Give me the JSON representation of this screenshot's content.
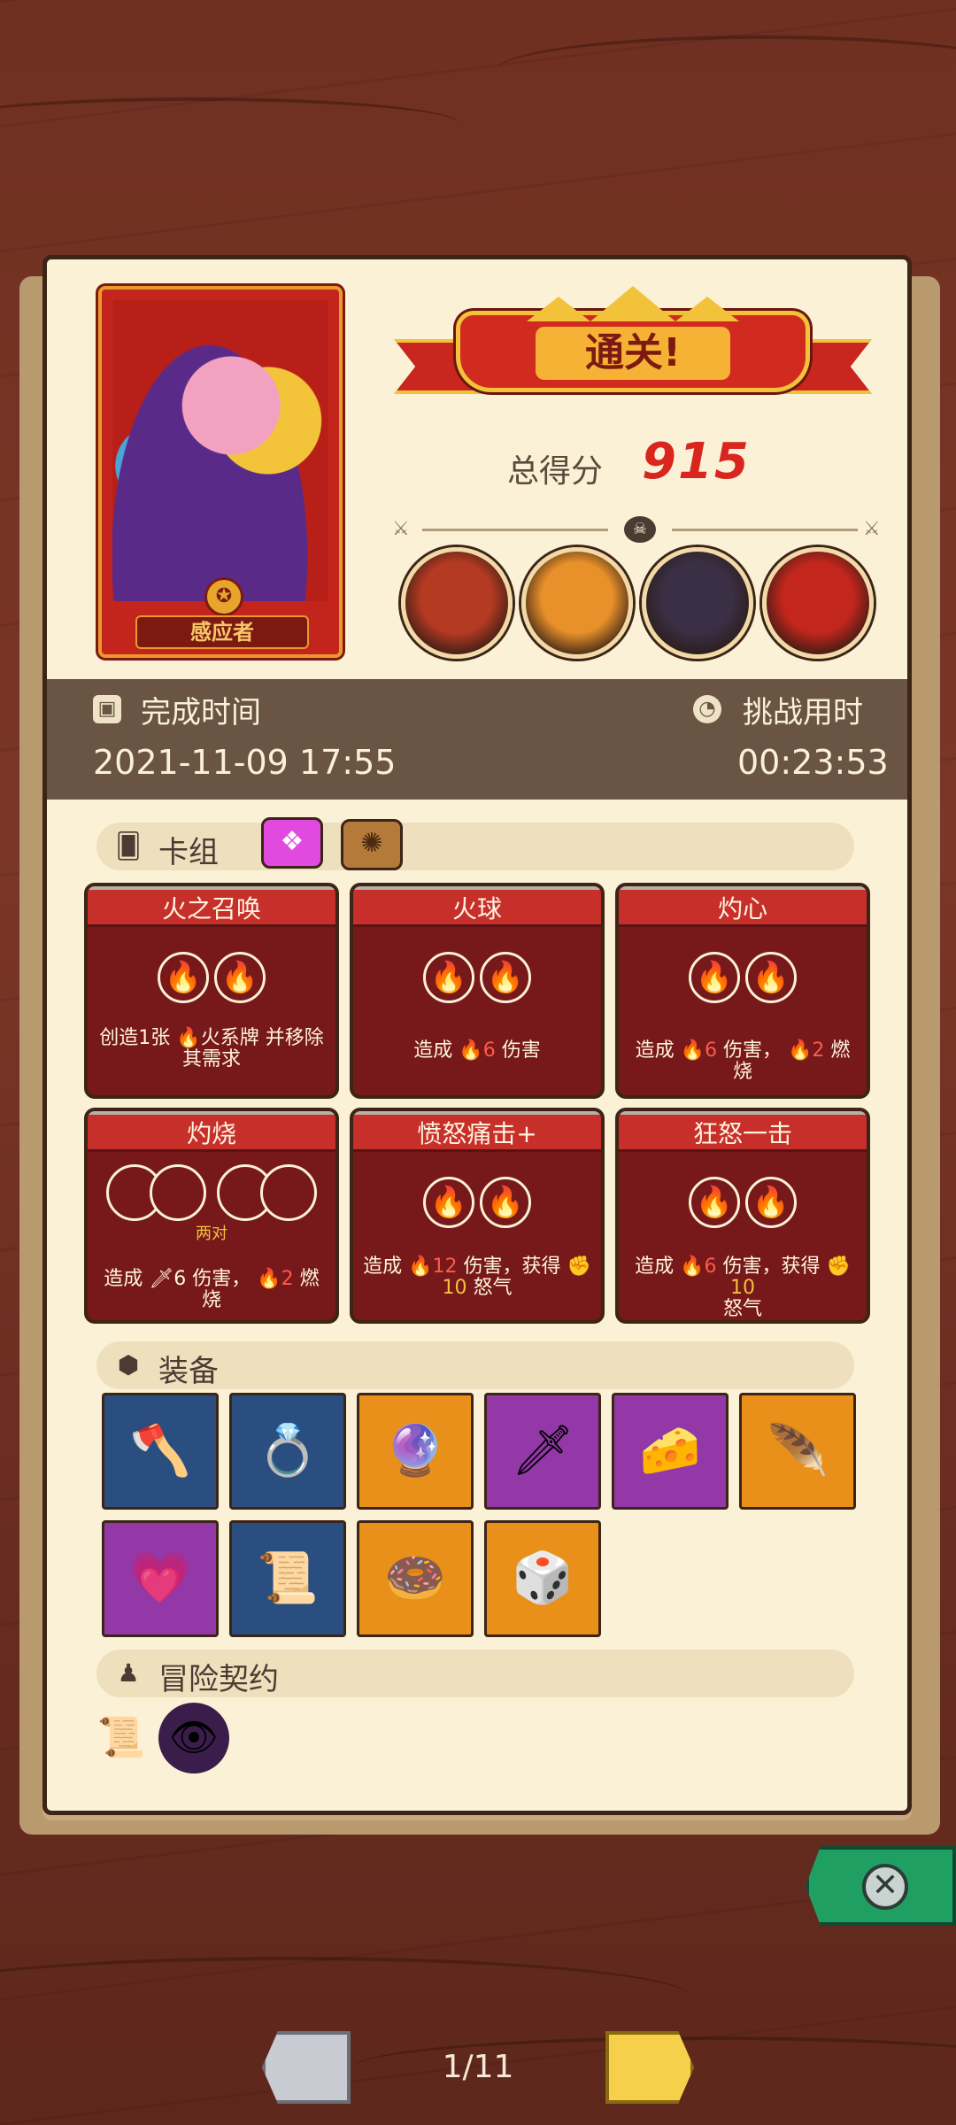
{
  "hero": {
    "name": "感应者"
  },
  "result": {
    "banner": "通关!",
    "score_label": "总得分",
    "score_value": "915"
  },
  "bosses": [
    {
      "icon": "cyclops-boss-icon",
      "color": "#b53a22"
    },
    {
      "icon": "orange-beast-boss-icon",
      "color": "#e8902a"
    },
    {
      "icon": "dark-knight-boss-icon",
      "color": "#3a2f44"
    },
    {
      "icon": "red-demon-boss-icon",
      "color": "#c2261d"
    }
  ],
  "timing": {
    "completion_label": "完成时间",
    "completion_value": "2021-11-09 17:55",
    "duration_label": "挑战用时",
    "duration_value": "00:23:53"
  },
  "deck": {
    "title": "卡组",
    "tabs": [
      {
        "icon": "pink-deck-tab-icon",
        "color": "#e04adf"
      },
      {
        "icon": "brown-deck-tab-icon",
        "color": "#b37a3a"
      }
    ],
    "cards": [
      {
        "name": "火之召唤",
        "desc_a": "创造1张",
        "desc_b": "火系牌 并移除",
        "desc_c": "其需求"
      },
      {
        "name": "火球",
        "desc_a": "造成",
        "num": "6",
        "desc_b": "伤害"
      },
      {
        "name": "灼心",
        "desc_a": "造成",
        "num": "6",
        "desc_b": "伤害，",
        "num2": "2",
        "desc_c": "燃烧"
      },
      {
        "name": "灼烧",
        "pair": "两对",
        "desc_a": "造成",
        "num": "6",
        "desc_b": "伤害，",
        "num2": "2",
        "desc_c": "燃烧"
      },
      {
        "name": "愤怒痛击+",
        "desc_a": "造成",
        "num": "12",
        "desc_b": "伤害，获得",
        "num2": "10",
        "desc_c": "怒气"
      },
      {
        "name": "狂怒一击",
        "desc_a": "造成",
        "num": "6",
        "desc_b": "伤害，获得",
        "num2": "10",
        "desc_c": "怒气"
      }
    ]
  },
  "equipment": {
    "title": "装备",
    "items": [
      {
        "icon": "axe-icon",
        "glyph": "🪓"
      },
      {
        "icon": "ring-icon",
        "glyph": "💍"
      },
      {
        "icon": "swirl-orb-icon",
        "glyph": "🔮"
      },
      {
        "icon": "curved-blade-icon",
        "glyph": "🗡"
      },
      {
        "icon": "cheese-wedge-icon",
        "glyph": "🧀"
      },
      {
        "icon": "green-feather-icon",
        "glyph": "🪶"
      },
      {
        "icon": "heart-charm-icon",
        "glyph": "💗"
      },
      {
        "icon": "scroll-icon",
        "glyph": "📜"
      },
      {
        "icon": "donut-ring-icon",
        "glyph": "🍩"
      },
      {
        "icon": "green-dice-icon",
        "glyph": "🎲"
      }
    ]
  },
  "contract": {
    "title": "冒险契约",
    "items": [
      {
        "icon": "contract-scroll-icon",
        "glyph": "📜"
      },
      {
        "icon": "purple-eye-seal-icon",
        "glyph": "👁"
      }
    ]
  },
  "pager": {
    "text": "1/11"
  }
}
